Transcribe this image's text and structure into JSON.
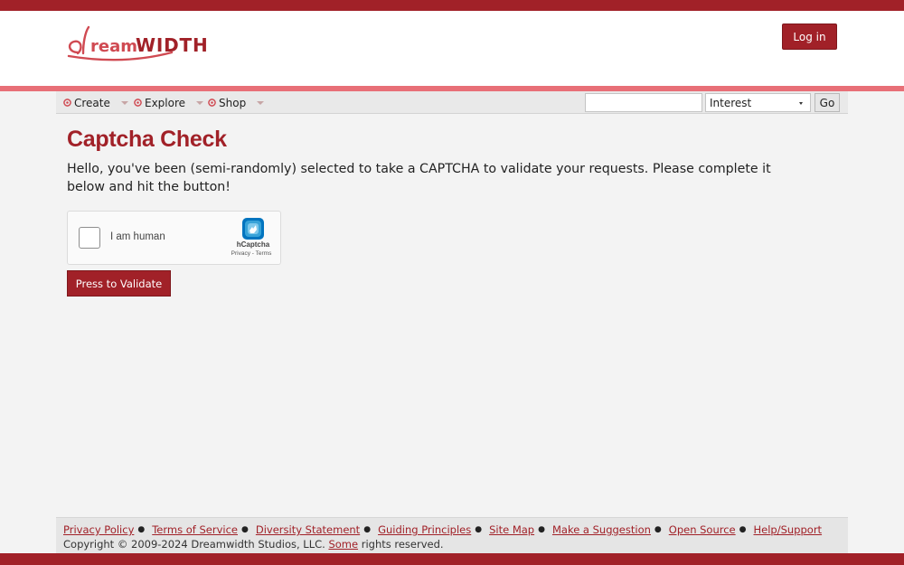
{
  "header": {
    "logo_text": "Dreamwidth",
    "login_label": "Log in"
  },
  "nav": {
    "items": [
      {
        "label": "Create",
        "icon": "swirl-icon"
      },
      {
        "label": "Explore",
        "icon": "swirl-icon"
      },
      {
        "label": "Shop",
        "icon": "swirl-icon"
      }
    ],
    "search": {
      "value": "",
      "placeholder": ""
    },
    "search_type": "Interest",
    "go_label": "Go"
  },
  "main": {
    "title": "Captcha Check",
    "intro": "Hello, you've been (semi-randomly) selected to take a CAPTCHA to validate your requests. Please complete it below and hit the button!",
    "captcha": {
      "label": "I am human",
      "brand": "hCaptcha",
      "privacy": "Privacy",
      "separator": "-",
      "terms": "Terms"
    },
    "validate_label": "Press to Validate"
  },
  "footer": {
    "links": [
      "Privacy Policy",
      "Terms of Service",
      "Diversity Statement",
      "Guiding Principles",
      "Site Map",
      "Make a Suggestion",
      "Open Source",
      "Help/Support"
    ],
    "copyright_prefix": "Copyright © 2009-2024 Dreamwidth Studios, LLC.",
    "copyright_link": "Some",
    "copyright_suffix": "rights reserved."
  },
  "colors": {
    "brand": "#a12128",
    "accent_pink": "#e86f77",
    "hcaptcha": "#0074bf"
  }
}
